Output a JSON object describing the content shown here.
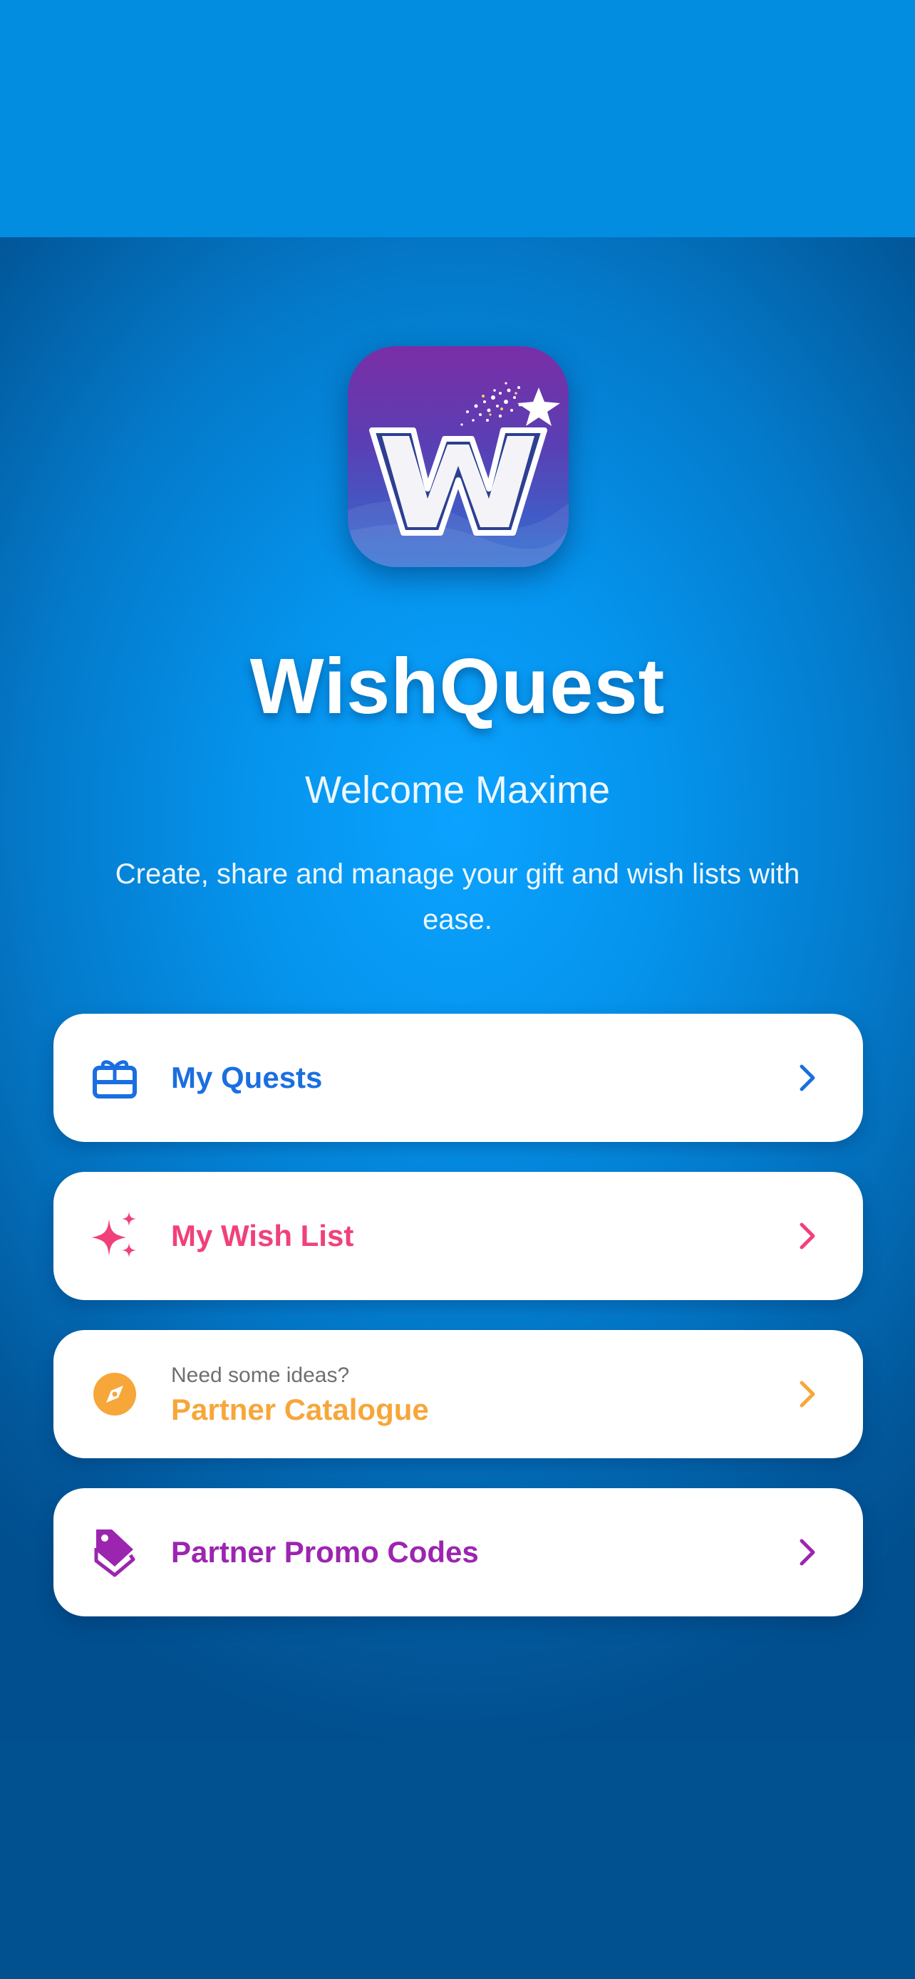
{
  "app": {
    "title": "WishQuest",
    "welcome": "Welcome Maxime",
    "tagline": "Create, share and manage your gift and wish lists with ease."
  },
  "logo": {
    "letter": "W"
  },
  "menu": {
    "quests": {
      "label": "My Quests",
      "icon": "gift-card-icon",
      "color": "#1a6fe0"
    },
    "wishlist": {
      "label": "My Wish List",
      "icon": "sparkles-icon",
      "color": "#f0417a"
    },
    "catalogue": {
      "subtitle": "Need some ideas?",
      "label": "Partner Catalogue",
      "icon": "compass-icon",
      "color": "#f7a63a"
    },
    "promo": {
      "label": "Partner Promo Codes",
      "icon": "tags-icon",
      "color": "#9c25b0"
    }
  }
}
